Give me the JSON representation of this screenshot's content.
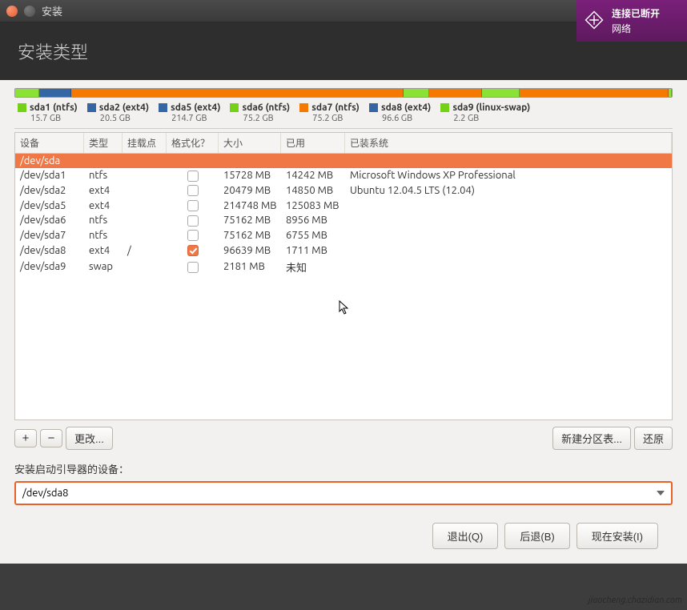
{
  "window": {
    "title": "安装"
  },
  "notification": {
    "title": "连接已断开",
    "subtitle": "网络"
  },
  "header": {
    "title": "安装类型"
  },
  "bar_segments": [
    {
      "color": "#8ae234",
      "pct": 3.7
    },
    {
      "color": "#3465a4",
      "pct": 4.8
    },
    {
      "color": "#f57900",
      "pct": 50.6
    },
    {
      "color": "#8ae234",
      "pct": 4.0
    },
    {
      "color": "#f57900",
      "pct": 8.0
    },
    {
      "color": "#8ae234",
      "pct": 5.7
    },
    {
      "color": "#f57900",
      "pct": 22.7
    },
    {
      "color": "#8ae234",
      "pct": 0.5
    }
  ],
  "legend": [
    {
      "color": "#73d216",
      "name": "sda1 (ntfs)",
      "size": "15.7 GB"
    },
    {
      "color": "#3465a4",
      "name": "sda2 (ext4)",
      "size": "20.5 GB"
    },
    {
      "color": "#3465a4",
      "name": "sda5 (ext4)",
      "size": "214.7 GB"
    },
    {
      "color": "#73d216",
      "name": "sda6 (ntfs)",
      "size": "75.2 GB"
    },
    {
      "color": "#f57900",
      "name": "sda7 (ntfs)",
      "size": "75.2 GB"
    },
    {
      "color": "#3465a4",
      "name": "sda8 (ext4)",
      "size": "96.6 GB"
    },
    {
      "color": "#73d216",
      "name": "sda9 (linux-swap)",
      "size": "2.2 GB"
    }
  ],
  "table": {
    "headers": {
      "device": "设备",
      "type": "类型",
      "mount": "挂载点",
      "format": "格式化？",
      "size": "大小",
      "used": "已用",
      "system": "已装系统"
    },
    "parent": "/dev/sda",
    "rows": [
      {
        "device": "/dev/sda1",
        "type": "ntfs",
        "mount": "",
        "format": false,
        "size": "15728 MB",
        "used": "14242 MB",
        "system": "Microsoft Windows XP Professional"
      },
      {
        "device": "/dev/sda2",
        "type": "ext4",
        "mount": "",
        "format": false,
        "size": "20479 MB",
        "used": "14850 MB",
        "system": "Ubuntu 12.04.5 LTS (12.04)"
      },
      {
        "device": "/dev/sda5",
        "type": "ext4",
        "mount": "",
        "format": false,
        "size": "214748 MB",
        "used": "125083 MB",
        "system": ""
      },
      {
        "device": "/dev/sda6",
        "type": "ntfs",
        "mount": "",
        "format": false,
        "size": "75162 MB",
        "used": "8956 MB",
        "system": ""
      },
      {
        "device": "/dev/sda7",
        "type": "ntfs",
        "mount": "",
        "format": false,
        "size": "75162 MB",
        "used": "6755 MB",
        "system": ""
      },
      {
        "device": "/dev/sda8",
        "type": "ext4",
        "mount": "/",
        "format": true,
        "size": "96639 MB",
        "used": "1711 MB",
        "system": ""
      },
      {
        "device": "/dev/sda9",
        "type": "swap",
        "mount": "",
        "format": false,
        "size": "2181 MB",
        "used": "未知",
        "system": ""
      }
    ]
  },
  "toolbar": {
    "add": "+",
    "remove": "−",
    "change": "更改...",
    "new_table": "新建分区表...",
    "revert": "还原"
  },
  "bootloader": {
    "label": "安装启动引导器的设备：",
    "value": "/dev/sda8"
  },
  "footer": {
    "quit": "退出(Q)",
    "back": "后退(B)",
    "install": "现在安装(I)"
  },
  "watermark": "jiaocheng.chazidian.com"
}
